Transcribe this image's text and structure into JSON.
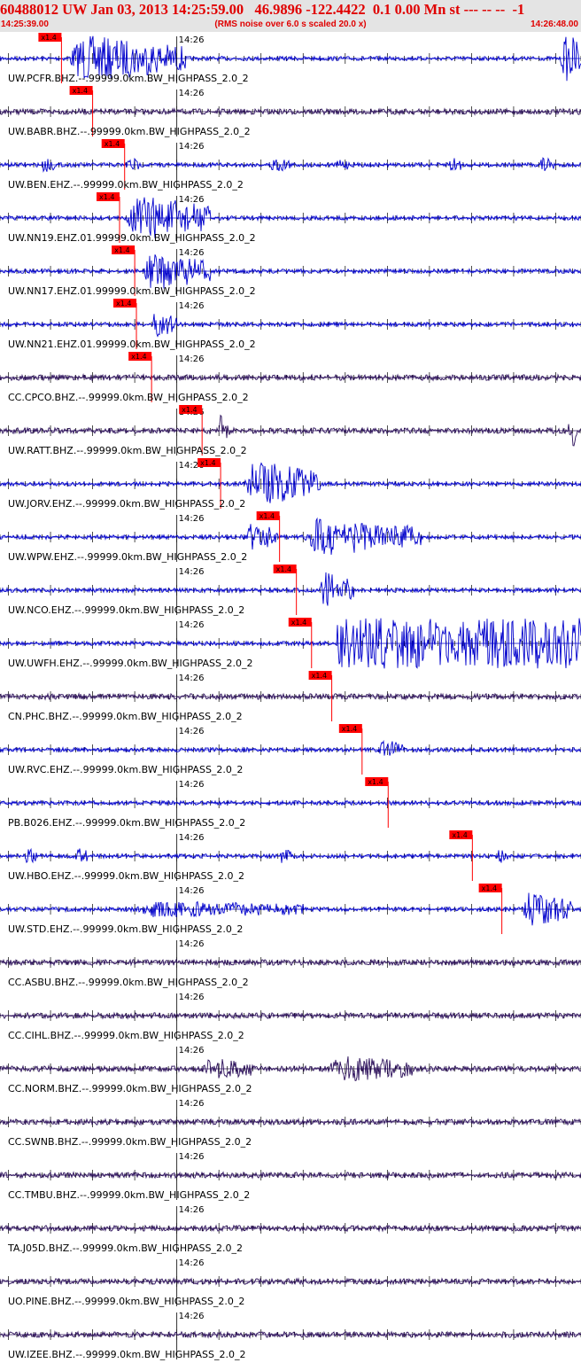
{
  "header": {
    "title": "60488012 UW Jan 03, 2013 14:25:59.00   46.9896 -122.4422  0.1 0.00 Mn st --- -- --  -1",
    "start_time": "14:25:39.00",
    "rms_note": "(RMS noise over 6.0 s scaled 20.0 x)",
    "end_time": "14:26:48.00"
  },
  "colors": {
    "trace_blue": "#0000cc",
    "trace_dark": "#2b0f5a",
    "pick": "#ff0000",
    "header_bg": "#e4e4e4",
    "header_text": "#e00000"
  },
  "chart_data": {
    "type": "line",
    "time_range": [
      "14:25:39.00",
      "14:26:48.00"
    ],
    "minute_tick_label": "14:26",
    "pick_label": "x1.4",
    "traces": [
      {
        "label": "UW.PCFR.BHZ.--.99999.0km.BW_HIGHPASS_2.0_2",
        "color": "blue",
        "pick": "14:25:46.3",
        "bursts": [
          {
            "t": 47,
            "dur": 14,
            "amp": 1.0
          },
          {
            "t": 105.5,
            "dur": 5,
            "amp": 1.0
          }
        ]
      },
      {
        "label": "UW.BABR.BHZ.--.99999.0km.BW_HIGHPASS_2.0_2",
        "color": "dark",
        "pick": "14:25:50.0",
        "bursts": []
      },
      {
        "label": "UW.BEN.EHZ.--.99999.0km.BW_HIGHPASS_2.0_2",
        "color": "blue",
        "pick": "14:25:53.8",
        "bursts": [
          {
            "t": 44,
            "dur": 1.5,
            "amp": 0.3
          },
          {
            "t": 54,
            "dur": 1.5,
            "amp": 0.3
          },
          {
            "t": 71,
            "dur": 2.5,
            "amp": 0.3
          },
          {
            "t": 79,
            "dur": 1.5,
            "amp": 0.2
          },
          {
            "t": 92,
            "dur": 2,
            "amp": 0.3
          },
          {
            "t": 103,
            "dur": 2,
            "amp": 0.3
          }
        ]
      },
      {
        "label": "UW.NN19.EHZ.01.99999.0km.BW_HIGHPASS_2.0_2",
        "color": "blue",
        "pick": "14:25:53.2",
        "bursts": [
          {
            "t": 54,
            "dur": 10,
            "amp": 1.0
          }
        ]
      },
      {
        "label": "UW.NN17.EHZ.01.99999.0km.BW_HIGHPASS_2.0_2",
        "color": "blue",
        "pick": "14:25:55.0",
        "bursts": [
          {
            "t": 56,
            "dur": 8,
            "amp": 0.8
          }
        ]
      },
      {
        "label": "UW.NN21.EHZ.01.99999.0km.BW_HIGHPASS_2.0_2",
        "color": "blue",
        "pick": "14:25:55.2",
        "bursts": [
          {
            "t": 57,
            "dur": 3,
            "amp": 0.5
          }
        ]
      },
      {
        "label": "CC.CPCO.BHZ.--.99999.0km.BW_HIGHPASS_2.0_2",
        "color": "dark",
        "pick": "14:25:57.0",
        "bursts": []
      },
      {
        "label": "UW.RATT.BHZ.--.99999.0km.BW_HIGHPASS_2.0_2",
        "color": "dark",
        "pick": "14:26:03.0",
        "bursts": [
          {
            "t": 65,
            "dur": 1.5,
            "amp": 0.6
          },
          {
            "t": 106.5,
            "dur": 1,
            "amp": 1.0
          }
        ]
      },
      {
        "label": "UW.JORV.EHZ.--.99999.0km.BW_HIGHPASS_2.0_2",
        "color": "blue",
        "pick": "14:26:05.2",
        "bursts": [
          {
            "t": 68,
            "dur": 9,
            "amp": 1.0
          }
        ]
      },
      {
        "label": "UW.WPW.EHZ.--.99999.0km.BW_HIGHPASS_2.0_2",
        "color": "blue",
        "pick": "14:26:12.2",
        "bursts": [
          {
            "t": 68,
            "dur": 4,
            "amp": 0.6
          },
          {
            "t": 75,
            "dur": 14,
            "amp": 0.8
          }
        ]
      },
      {
        "label": "UW.NCO.EHZ.--.99999.0km.BW_HIGHPASS_2.0_2",
        "color": "blue",
        "pick": "14:26:14.2",
        "bursts": [
          {
            "t": 77,
            "dur": 4,
            "amp": 0.8
          }
        ]
      },
      {
        "label": "UW.UWFH.EHZ.--.99999.0km.BW_HIGHPASS_2.0_2",
        "color": "blue",
        "pick": "14:26:16.0",
        "bursts": [
          {
            "t": 79,
            "dur": 30,
            "amp": 1.0
          }
        ]
      },
      {
        "label": "CN.PHC.BHZ.--.99999.0km.BW_HIGHPASS_2.0_2",
        "color": "dark",
        "pick": "14:26:18.4",
        "bursts": []
      },
      {
        "label": "UW.RVC.EHZ.--.99999.0km.BW_HIGHPASS_2.0_2",
        "color": "blue",
        "pick": "14:26:22.0",
        "bursts": [
          {
            "t": 84,
            "dur": 3,
            "amp": 0.4
          }
        ]
      },
      {
        "label": "PB.B026.EHZ.--.99999.0km.BW_HIGHPASS_2.0_2",
        "color": "blue",
        "pick": "14:26:25.1",
        "bursts": []
      },
      {
        "label": "UW.HBO.EHZ.--.99999.0km.BW_HIGHPASS_2.0_2",
        "color": "blue",
        "pick": "14:26:35.1",
        "bursts": [
          {
            "t": 42,
            "dur": 1.5,
            "amp": 0.3
          },
          {
            "t": 48,
            "dur": 1.5,
            "amp": 0.3
          },
          {
            "t": 72,
            "dur": 1.5,
            "amp": 0.3
          },
          {
            "t": 98,
            "dur": 1.5,
            "amp": 0.3
          }
        ]
      },
      {
        "label": "UW.STD.EHZ.--.99999.0km.BW_HIGHPASS_2.0_2",
        "color": "blue",
        "pick": "14:26:38.6",
        "bursts": [
          {
            "t": 55,
            "dur": 20,
            "amp": 0.3
          },
          {
            "t": 101,
            "dur": 6,
            "amp": 0.7
          }
        ]
      },
      {
        "label": "CC.ASBU.BHZ.--.99999.0km.BW_HIGHPASS_2.0_2",
        "color": "dark",
        "pick": null,
        "bursts": []
      },
      {
        "label": "CC.CIHL.BHZ.--.99999.0km.BW_HIGHPASS_2.0_2",
        "color": "dark",
        "pick": null,
        "bursts": []
      },
      {
        "label": "CC.NORM.BHZ.--.99999.0km.BW_HIGHPASS_2.0_2",
        "color": "dark",
        "pick": null,
        "bursts": [
          {
            "t": 63,
            "dur": 6,
            "amp": 0.4
          },
          {
            "t": 78,
            "dur": 10,
            "amp": 0.5
          }
        ]
      },
      {
        "label": "CC.SWNB.BHZ.--.99999.0km.BW_HIGHPASS_2.0_2",
        "color": "dark",
        "pick": null,
        "bursts": []
      },
      {
        "label": "CC.TMBU.BHZ.--.99999.0km.BW_HIGHPASS_2.0_2",
        "color": "dark",
        "pick": null,
        "bursts": []
      },
      {
        "label": "TA.J05D.BHZ.--.99999.0km.BW_HIGHPASS_2.0_2",
        "color": "dark",
        "pick": null,
        "bursts": []
      },
      {
        "label": "UO.PINE.BHZ.--.99999.0km.BW_HIGHPASS_2.0_2",
        "color": "dark",
        "pick": null,
        "bursts": []
      },
      {
        "label": "UW.IZEE.BHZ.--.99999.0km.BW_HIGHPASS_2.0_2",
        "color": "dark",
        "pick": null,
        "bursts": []
      }
    ]
  }
}
